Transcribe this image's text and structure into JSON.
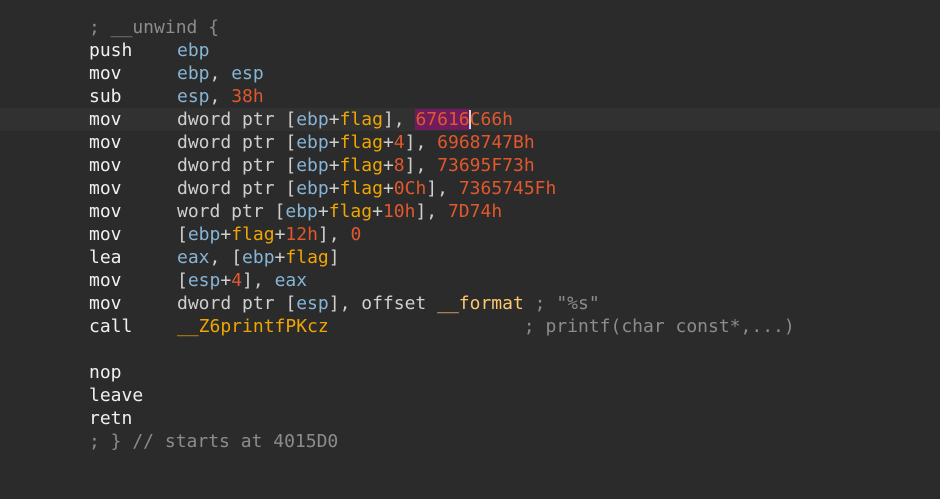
{
  "listing": {
    "proc_start_comment": "; __unwind {",
    "proc_end_comment": "; } // starts at 4015D0",
    "lines": [
      {
        "mnemonic": "push",
        "operands": [
          {
            "t": "ebp",
            "k": "reg"
          }
        ]
      },
      {
        "mnemonic": "mov",
        "operands": [
          {
            "t": "ebp",
            "k": "reg"
          },
          {
            "t": ", ",
            "k": "plain"
          },
          {
            "t": "esp",
            "k": "reg"
          }
        ]
      },
      {
        "mnemonic": "sub",
        "operands": [
          {
            "t": "esp",
            "k": "reg"
          },
          {
            "t": ", ",
            "k": "plain"
          },
          {
            "t": "38h",
            "k": "num"
          }
        ]
      },
      {
        "mnemonic": "mov",
        "operands": [
          {
            "t": "dword ptr [",
            "k": "plain"
          },
          {
            "t": "ebp",
            "k": "reg"
          },
          {
            "t": "+",
            "k": "plain"
          },
          {
            "t": "flag",
            "k": "var"
          },
          {
            "t": "], ",
            "k": "plain"
          },
          {
            "t": "67616",
            "k": "hl"
          },
          {
            "t": "C66h",
            "k": "num"
          }
        ],
        "current": true
      },
      {
        "mnemonic": "mov",
        "operands": [
          {
            "t": "dword ptr [",
            "k": "plain"
          },
          {
            "t": "ebp",
            "k": "reg"
          },
          {
            "t": "+",
            "k": "plain"
          },
          {
            "t": "flag",
            "k": "var"
          },
          {
            "t": "+",
            "k": "plain"
          },
          {
            "t": "4",
            "k": "num"
          },
          {
            "t": "], ",
            "k": "plain"
          },
          {
            "t": "6968747Bh",
            "k": "num"
          }
        ]
      },
      {
        "mnemonic": "mov",
        "operands": [
          {
            "t": "dword ptr [",
            "k": "plain"
          },
          {
            "t": "ebp",
            "k": "reg"
          },
          {
            "t": "+",
            "k": "plain"
          },
          {
            "t": "flag",
            "k": "var"
          },
          {
            "t": "+",
            "k": "plain"
          },
          {
            "t": "8",
            "k": "num"
          },
          {
            "t": "], ",
            "k": "plain"
          },
          {
            "t": "73695F73h",
            "k": "num"
          }
        ]
      },
      {
        "mnemonic": "mov",
        "operands": [
          {
            "t": "dword ptr [",
            "k": "plain"
          },
          {
            "t": "ebp",
            "k": "reg"
          },
          {
            "t": "+",
            "k": "plain"
          },
          {
            "t": "flag",
            "k": "var"
          },
          {
            "t": "+",
            "k": "plain"
          },
          {
            "t": "0Ch",
            "k": "num"
          },
          {
            "t": "], ",
            "k": "plain"
          },
          {
            "t": "7365745Fh",
            "k": "num"
          }
        ]
      },
      {
        "mnemonic": "mov",
        "operands": [
          {
            "t": "word ptr [",
            "k": "plain"
          },
          {
            "t": "ebp",
            "k": "reg"
          },
          {
            "t": "+",
            "k": "plain"
          },
          {
            "t": "flag",
            "k": "var"
          },
          {
            "t": "+",
            "k": "plain"
          },
          {
            "t": "10h",
            "k": "num"
          },
          {
            "t": "], ",
            "k": "plain"
          },
          {
            "t": "7D74h",
            "k": "num"
          }
        ]
      },
      {
        "mnemonic": "mov",
        "operands": [
          {
            "t": "[",
            "k": "plain"
          },
          {
            "t": "ebp",
            "k": "reg"
          },
          {
            "t": "+",
            "k": "plain"
          },
          {
            "t": "flag",
            "k": "var"
          },
          {
            "t": "+",
            "k": "plain"
          },
          {
            "t": "12h",
            "k": "num"
          },
          {
            "t": "], ",
            "k": "plain"
          },
          {
            "t": "0",
            "k": "num"
          }
        ]
      },
      {
        "mnemonic": "lea",
        "operands": [
          {
            "t": "eax",
            "k": "reg"
          },
          {
            "t": ", [",
            "k": "plain"
          },
          {
            "t": "ebp",
            "k": "reg"
          },
          {
            "t": "+",
            "k": "plain"
          },
          {
            "t": "flag",
            "k": "var"
          },
          {
            "t": "]",
            "k": "plain"
          }
        ]
      },
      {
        "mnemonic": "mov",
        "operands": [
          {
            "t": "[",
            "k": "plain"
          },
          {
            "t": "esp",
            "k": "reg"
          },
          {
            "t": "+",
            "k": "plain"
          },
          {
            "t": "4",
            "k": "num"
          },
          {
            "t": "], ",
            "k": "plain"
          },
          {
            "t": "eax",
            "k": "reg"
          }
        ]
      },
      {
        "mnemonic": "mov",
        "operands": [
          {
            "t": "dword ptr [",
            "k": "plain"
          },
          {
            "t": "esp",
            "k": "reg"
          },
          {
            "t": "], offset ",
            "k": "plain"
          },
          {
            "t": "__format",
            "k": "sym"
          },
          {
            "t": " ; \"%s\"",
            "k": "cm"
          }
        ]
      },
      {
        "mnemonic": "call",
        "operands": [
          {
            "t": "__Z6printfPKcz",
            "k": "var"
          },
          {
            "t": "                  ; printf(char const*,...)",
            "k": "cm"
          }
        ]
      },
      {
        "blank": true
      },
      {
        "mnemonic": "nop",
        "operands": []
      },
      {
        "mnemonic": "leave",
        "operands": []
      },
      {
        "mnemonic": "retn",
        "operands": []
      }
    ]
  },
  "colors": {
    "background": "#2b2b2b",
    "current_line": "#313131",
    "mnemonic": "#f0f0f0",
    "register": "#87b5d6",
    "number": "#e0582c",
    "variable": "#f0a600",
    "comment": "#8c8c8c",
    "highlight": "#6e1c5e"
  }
}
